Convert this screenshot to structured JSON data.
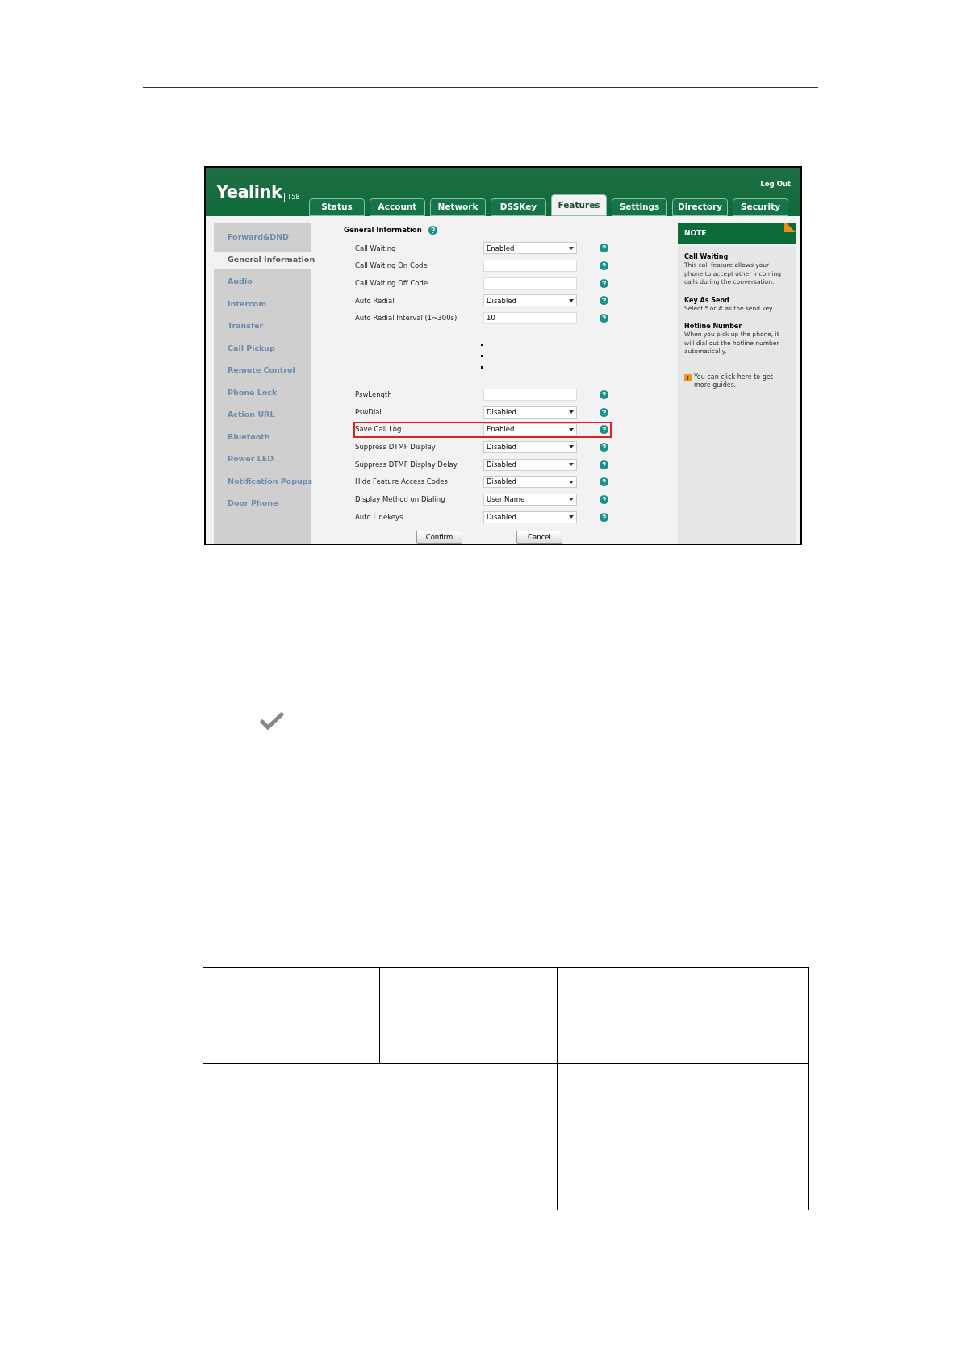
{
  "header": {
    "logo": "Yealink",
    "model": "T58",
    "logout": "Log Out"
  },
  "tabs": [
    {
      "label": "Status",
      "selected": false
    },
    {
      "label": "Account",
      "selected": false
    },
    {
      "label": "Network",
      "selected": false
    },
    {
      "label": "DSSKey",
      "selected": false
    },
    {
      "label": "Features",
      "selected": true
    },
    {
      "label": "Settings",
      "selected": false
    },
    {
      "label": "Directory",
      "selected": false
    },
    {
      "label": "Security",
      "selected": false
    }
  ],
  "sidebar": {
    "items": [
      {
        "label": "Forward&DND",
        "selected": false
      },
      {
        "label": "General Information",
        "selected": true
      },
      {
        "label": "Audio",
        "selected": false
      },
      {
        "label": "Intercom",
        "selected": false
      },
      {
        "label": "Transfer",
        "selected": false
      },
      {
        "label": "Call Pickup",
        "selected": false
      },
      {
        "label": "Remote Control",
        "selected": false
      },
      {
        "label": "Phone Lock",
        "selected": false
      },
      {
        "label": "Action URL",
        "selected": false
      },
      {
        "label": "Bluetooth",
        "selected": false
      },
      {
        "label": "Power LED",
        "selected": false
      },
      {
        "label": "Notification Popups",
        "selected": false
      },
      {
        "label": "Door Phone",
        "selected": false
      }
    ]
  },
  "form": {
    "title": "General Information",
    "rows": [
      {
        "kind": "select",
        "label": "Call Waiting",
        "value": "Enabled",
        "highlighted": false
      },
      {
        "kind": "input",
        "label": "Call Waiting On Code",
        "highlighted": false
      },
      {
        "kind": "input",
        "label": "Call Waiting Off Code",
        "highlighted": false
      },
      {
        "kind": "select",
        "label": "Auto Redial",
        "value": "Disabled",
        "highlighted": false
      },
      {
        "kind": "input",
        "label": "Auto Redial Interval (1~300s)",
        "value": "10",
        "highlighted": false
      },
      {
        "kind": "gap"
      },
      {
        "kind": "input",
        "label": "PswLength",
        "highlighted": false
      },
      {
        "kind": "select",
        "label": "PswDial",
        "value": "Disabled",
        "highlighted": false
      },
      {
        "kind": "select",
        "label": "Save Call Log",
        "value": "Enabled",
        "highlighted": true
      },
      {
        "kind": "select",
        "label": "Suppress DTMF Display",
        "value": "Disabled",
        "highlighted": false
      },
      {
        "kind": "select",
        "label": "Suppress DTMF Display Delay",
        "value": "Disabled",
        "highlighted": false
      },
      {
        "kind": "select",
        "label": "Hide Feature Access Codes",
        "value": "Disabled",
        "highlighted": false
      },
      {
        "kind": "select",
        "label": "Display Method on Dialing",
        "value": "User Name",
        "highlighted": false
      },
      {
        "kind": "select",
        "label": "Auto Linekeys",
        "value": "Disabled",
        "highlighted": false
      }
    ],
    "buttons": [
      "Confirm",
      "Cancel"
    ]
  },
  "note": {
    "title": "NOTE",
    "sections": [
      {
        "heading": "Call Waiting",
        "text": "This call feature allows your phone to accept other incoming calls during the conversation."
      },
      {
        "heading": "Key As Send",
        "text": "Select * or # as the send key."
      },
      {
        "heading": "Hotline Number",
        "text": "When you pick up the phone, it will dial out the hotline number automatically."
      }
    ],
    "guide": "You can click here to get more guides."
  }
}
